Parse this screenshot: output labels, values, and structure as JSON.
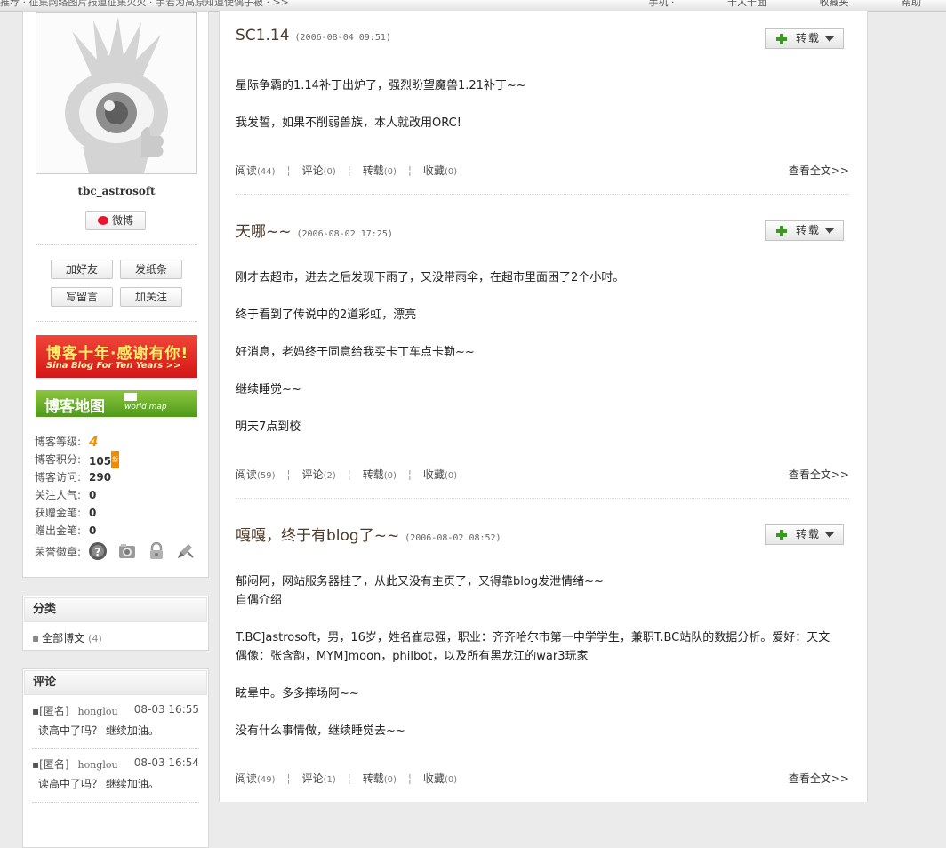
{
  "topbar": {
    "notice": "推荐 · 征集网络图片报道征集火火 · 手若为高原知道使偶子被 · >>",
    "links": [
      "手机 ·",
      "千人千面",
      "收藏夹",
      "帮助"
    ]
  },
  "profile": {
    "username": "tbc_astrosoft",
    "weibo_label": "微博",
    "actions": [
      "加好友",
      "发纸条",
      "写留言",
      "加关注"
    ],
    "banner1": {
      "line1": "博客十年·感谢有你!",
      "line2": "Sina Blog For Ten Years >>"
    },
    "banner2": {
      "line1": "博客地图",
      "line2": "world map"
    },
    "stats": [
      {
        "label": "博客等级:",
        "value": "4"
      },
      {
        "label": "博客积分:",
        "value": "105"
      },
      {
        "label": "博客访问:",
        "value": "290"
      },
      {
        "label": "关注人气:",
        "value": "0"
      },
      {
        "label": "获赠金笔:",
        "value": "0"
      },
      {
        "label": "赠出金笔:",
        "value": "0"
      },
      {
        "label": "荣誉徽章:",
        "value": ""
      }
    ],
    "new_badge": "新"
  },
  "categories": {
    "title": "分类",
    "items": [
      {
        "label": "全部博文",
        "count": "(4)"
      }
    ]
  },
  "comments": {
    "title": "评论",
    "items": [
      {
        "author": "[匿名]",
        "nick": "honglou",
        "time": "08-03 16:55",
        "text": "读高中了吗？  继续加油。"
      },
      {
        "author": "[匿名]",
        "nick": "honglou",
        "time": "08-03 16:54",
        "text": "读高中了吗？  继续加油。"
      }
    ]
  },
  "zz_label": "转载",
  "posts": [
    {
      "title": "SC1.14",
      "time": "(2006-08-04 09:51)",
      "paragraphs": [
        "星际争霸的1.14补丁出炉了，强烈盼望魔兽1.21补丁~~",
        "我发誓，如果不削弱兽族，本人就改用ORC!"
      ],
      "read": "阅读",
      "read_count": "(44)",
      "comment": "评论",
      "comment_count": "(0)",
      "repost": "转载",
      "repost_count": "(0)",
      "fav": "收藏",
      "fav_count": "(0)",
      "more": "查看全文>>"
    },
    {
      "title": "天哪~~",
      "time": "(2006-08-02 17:25)",
      "paragraphs": [
        "刚才去超市，进去之后发现下雨了，又没带雨伞，在超市里面困了2个小时。",
        "终于看到了传说中的2道彩虹，漂亮",
        "好消息，老妈终于同意给我买卡丁车点卡勒~~",
        "继续睡觉~~",
        "明天7点到校"
      ],
      "read": "阅读",
      "read_count": "(59)",
      "comment": "评论",
      "comment_count": "(2)",
      "repost": "转载",
      "repost_count": "(0)",
      "fav": "收藏",
      "fav_count": "(0)",
      "more": "查看全文>>"
    },
    {
      "title": "嘎嘎，终于有blog了~~",
      "time": "(2006-08-02 08:52)",
      "paragraphs": [
        "郁闷阿，网站服务器挂了，从此又没有主页了，又得靠blog发泄情绪~~\n自偶介绍",
        "T.BC]astrosoft，男，16岁，姓名崔忠强，职业：齐齐哈尔市第一中学学生，兼职T.BC站队的数据分析。爱好：天文  偶像：张含韵，MYM]moon，philbot，以及所有黑龙江的war3玩家",
        "眩晕中。多多捧场阿~~",
        "没有什么事情做，继续睡觉去~~"
      ],
      "read": "阅读",
      "read_count": "(49)",
      "comment": "评论",
      "comment_count": "(1)",
      "repost": "转载",
      "repost_count": "(0)",
      "fav": "收藏",
      "fav_count": "(0)",
      "more": "查看全文>>"
    }
  ]
}
